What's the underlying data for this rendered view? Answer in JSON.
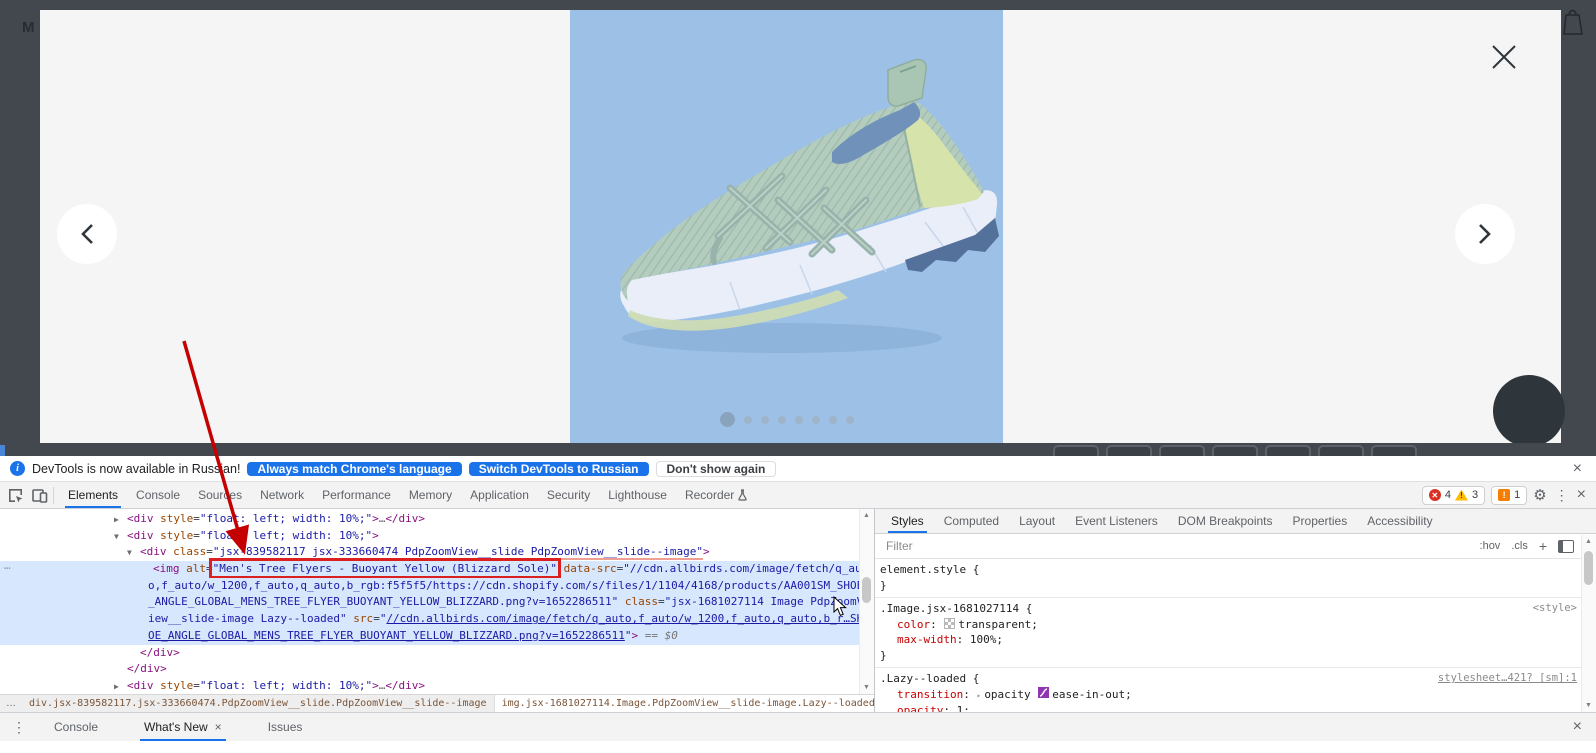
{
  "colors": {
    "accent": "#1a73e8",
    "selection": "#d7e7fd",
    "error": "#d93025",
    "warning": "#fbbc04",
    "issue": "#f57d00",
    "annotation": "#c40000",
    "page_dark": "#42484e",
    "image_highlight": "#9dc1e6"
  },
  "page": {
    "nav_letter": "M",
    "modal": {
      "close_label": "×",
      "prev_label": "chevron-left",
      "next_label": "chevron-right"
    },
    "carousel": {
      "dot_count": 8,
      "active_dot": 1
    },
    "background_size_button_count": 7
  },
  "notification": {
    "text": "DevTools is now available in Russian!",
    "buttons": [
      {
        "label": "Always match Chrome's language",
        "style": "primary"
      },
      {
        "label": "Switch DevTools to Russian",
        "style": "primary"
      },
      {
        "label": "Don't show again",
        "style": "secondary"
      }
    ],
    "close": "×"
  },
  "toolbar": {
    "tabs": [
      {
        "label": "Elements",
        "active": true
      },
      {
        "label": "Console"
      },
      {
        "label": "Sources"
      },
      {
        "label": "Network"
      },
      {
        "label": "Performance"
      },
      {
        "label": "Memory"
      },
      {
        "label": "Application"
      },
      {
        "label": "Security"
      },
      {
        "label": "Lighthouse"
      },
      {
        "label": "Recorder",
        "experiment": true
      }
    ],
    "errors": "4",
    "warnings": "3",
    "issues": "1",
    "error_glyph": "✕",
    "warning_glyph": "!",
    "issue_glyph": "!",
    "gear": "⚙",
    "kebab": "⋮",
    "close": "×"
  },
  "elements": {
    "gutter_more": "…",
    "lines": [
      {
        "indent": 114,
        "arrow": "▶",
        "tokens": [
          [
            "tag",
            "<div"
          ],
          [
            "attr",
            " style"
          ],
          [
            "plain",
            "="
          ],
          [
            "val",
            "\"float: left; width: 10%;\""
          ],
          [
            "tag",
            ">"
          ],
          [
            "dots",
            "…"
          ],
          [
            "tag",
            "</div>"
          ]
        ]
      },
      {
        "indent": 114,
        "arrow": "▼",
        "tokens": [
          [
            "tag",
            "<div"
          ],
          [
            "attr",
            " style"
          ],
          [
            "plain",
            "="
          ],
          [
            "val",
            "\"float: left; width: 10%;\""
          ],
          [
            "tag",
            ">"
          ]
        ]
      },
      {
        "indent": 127,
        "arrow": "▼",
        "tokens": [
          [
            "tag",
            "<div"
          ],
          [
            "attr",
            " class"
          ],
          [
            "plain",
            "="
          ],
          [
            "val redline",
            "\"jsx-839582117 jsx-333660474 PdpZoomView__slide PdpZoomView__slide--image\""
          ],
          [
            "tag",
            ">"
          ]
        ]
      },
      {
        "indent": 153,
        "selected": true,
        "gutter": true,
        "tokens": [
          [
            "tag",
            "<img"
          ],
          [
            "attr",
            " alt"
          ],
          [
            "plain",
            "="
          ],
          [
            "val redbox",
            "\"Men's Tree Flyers - Buoyant Yellow (Blizzard Sole)\""
          ],
          [
            "attr",
            " data-src"
          ],
          [
            "plain",
            "="
          ],
          [
            "val",
            "\"//cdn.allbirds.com/image/fetch/q_aut"
          ]
        ]
      },
      {
        "indent": 148,
        "selected": true,
        "tokens": [
          [
            "val",
            "o,f_auto/w_1200,f_auto,q_auto,b_rgb:f5f5f5/https://cdn.shopify.com/s/files/1/1104/4168/products/AA001SM_SHOE"
          ]
        ]
      },
      {
        "indent": 148,
        "selected": true,
        "tokens": [
          [
            "val",
            "_ANGLE_GLOBAL_MENS_TREE_FLYER_BUOYANT_YELLOW_BLIZZARD.png?v=1652286511\""
          ],
          [
            "attr",
            " class"
          ],
          [
            "plain",
            "="
          ],
          [
            "val",
            "\"jsx-1681027114 Image PdpZoomV"
          ]
        ]
      },
      {
        "indent": 148,
        "selected": true,
        "tokens": [
          [
            "val",
            "iew__slide-image Lazy--loaded\""
          ],
          [
            "attr",
            " src"
          ],
          [
            "plain",
            "="
          ],
          [
            "val",
            "\""
          ],
          [
            "link",
            "//cdn.allbirds.com/image/fetch/q_auto,f_auto/w_1200,f_auto,q_auto,b_r…SH"
          ]
        ]
      },
      {
        "indent": 148,
        "selected": true,
        "tokens": [
          [
            "link",
            "OE_ANGLE_GLOBAL_MENS_TREE_FLYER_BUOYANT_YELLOW_BLIZZARD.png?v=1652286511"
          ],
          [
            "val",
            "\""
          ],
          [
            "tag",
            ">"
          ],
          [
            "result",
            " == $0"
          ]
        ]
      },
      {
        "indent": 140,
        "tokens": [
          [
            "tag",
            "</div>"
          ]
        ]
      },
      {
        "indent": 127,
        "tokens": [
          [
            "tag",
            "</div>"
          ]
        ]
      },
      {
        "indent": 114,
        "arrow": "▶",
        "tokens": [
          [
            "tag",
            "<div"
          ],
          [
            "attr",
            " style"
          ],
          [
            "plain",
            "="
          ],
          [
            "val",
            "\"float: left; width: 10%;\""
          ],
          [
            "tag",
            ">"
          ],
          [
            "dots",
            "…"
          ],
          [
            "tag",
            "</div>"
          ]
        ]
      }
    ]
  },
  "breadcrumb": {
    "overflow_left": "…",
    "overflow_right": "…",
    "crumbs": [
      {
        "label": "div.jsx-839582117.jsx-333660474.PdpZoomView__slide.PdpZoomView__slide--image",
        "active": false
      },
      {
        "label": "img.jsx-1681027114.Image.PdpZoomView__slide-image.Lazy--loaded",
        "active": true
      }
    ]
  },
  "styles": {
    "tabs": [
      {
        "label": "Styles",
        "active": true
      },
      {
        "label": "Computed"
      },
      {
        "label": "Layout"
      },
      {
        "label": "Event Listeners"
      },
      {
        "label": "DOM Breakpoints"
      },
      {
        "label": "Properties"
      },
      {
        "label": "Accessibility"
      }
    ],
    "filter_placeholder": "Filter",
    "toggles": [
      ":hov",
      ".cls",
      "+"
    ],
    "sections": [
      {
        "selector": "element.style",
        "props": []
      },
      {
        "selector": ".Image.jsx-1681027114",
        "source": "<style>",
        "source_underline": false,
        "props": [
          {
            "name": "color",
            "tokens": [
              {
                "swatch": "checker"
              },
              {
                "text": "transparent"
              }
            ]
          },
          {
            "name": "max-width",
            "tokens": [
              {
                "text": "100%"
              }
            ]
          }
        ]
      },
      {
        "selector": ".Lazy--loaded",
        "source": "stylesheet…421? [sm]:1",
        "source_underline": true,
        "props": [
          {
            "name": "transition",
            "tokens": [
              {
                "tri": true
              },
              {
                "text": "opacity "
              },
              {
                "swatch": "bezier"
              },
              {
                "text": "ease-in-out"
              }
            ]
          },
          {
            "name": "opacity",
            "tokens": [
              {
                "text": "1"
              }
            ]
          }
        ]
      }
    ]
  },
  "drawer": {
    "kebab": "⋮",
    "tabs": [
      {
        "label": "Console"
      },
      {
        "label": "What's New",
        "active": true,
        "closable": true
      },
      {
        "label": "Issues"
      }
    ],
    "close": "×"
  }
}
